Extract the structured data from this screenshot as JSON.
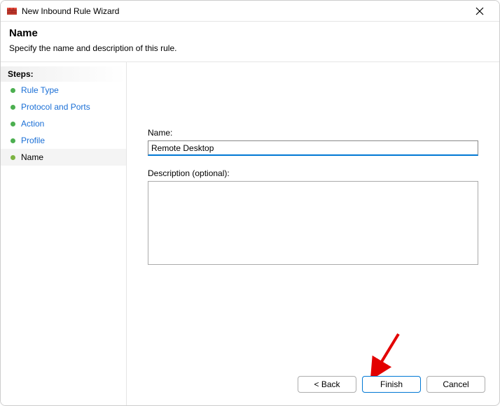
{
  "titlebar": {
    "title": "New Inbound Rule Wizard"
  },
  "header": {
    "title": "Name",
    "subtitle": "Specify the name and description of this rule."
  },
  "sidebar": {
    "header": "Steps:",
    "items": [
      {
        "label": "Rule Type",
        "current": false
      },
      {
        "label": "Protocol and Ports",
        "current": false
      },
      {
        "label": "Action",
        "current": false
      },
      {
        "label": "Profile",
        "current": false
      },
      {
        "label": "Name",
        "current": true
      }
    ]
  },
  "form": {
    "name_label": "Name:",
    "name_value": "Remote Desktop",
    "desc_label": "Description (optional):",
    "desc_value": ""
  },
  "footer": {
    "back": "< Back",
    "finish": "Finish",
    "cancel": "Cancel"
  }
}
